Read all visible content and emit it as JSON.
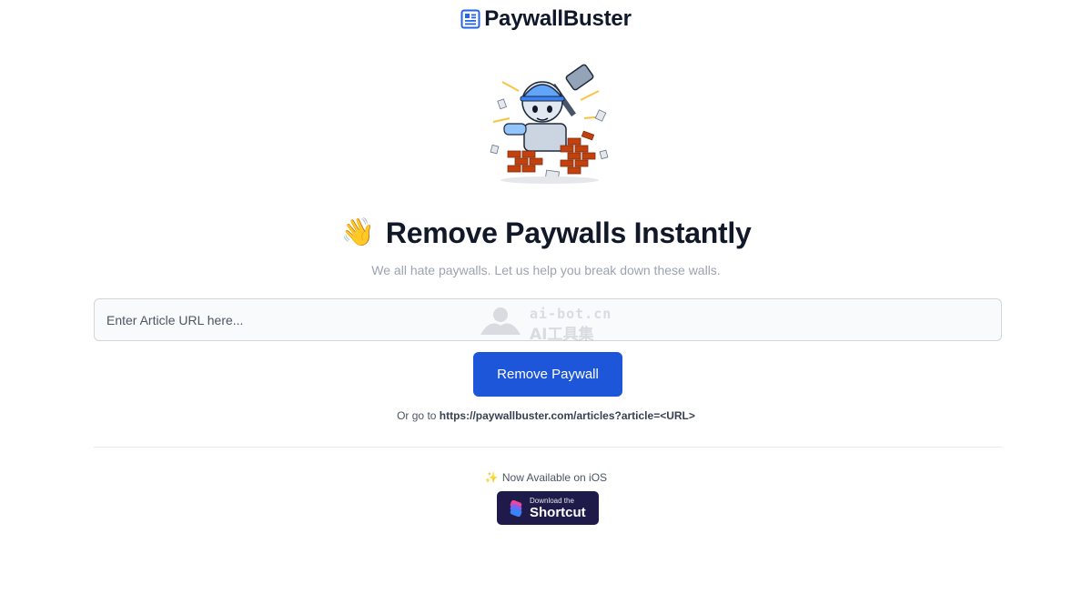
{
  "header": {
    "brand_name": "PaywallBuster",
    "brand_icon": "newspaper-icon",
    "brand_color": "#2563eb"
  },
  "hero": {
    "illustration": "hammer-robot-breaking-brick-wall-image"
  },
  "headline": {
    "emoji": "👋",
    "text": "Remove Paywalls Instantly"
  },
  "subtitle": "We all hate paywalls. Let us help you break down these walls.",
  "form": {
    "url_input_placeholder": "Enter Article URL here...",
    "url_input_value": "",
    "submit_label": "Remove Paywall",
    "button_color": "#1d56d8"
  },
  "alt_link": {
    "prefix": "Or go to ",
    "url": "https://paywallbuster.com/articles?article=<URL>"
  },
  "ios": {
    "sparkle": "✨",
    "text": "Now Available on iOS",
    "badge_small": "Download the",
    "badge_big": "Shortcut",
    "badge_icon": "shortcuts-app-icon",
    "badge_color": "#1e1b4b"
  },
  "watermark": {
    "line1": "ai-bot.cn",
    "line2": "AI工具集"
  }
}
